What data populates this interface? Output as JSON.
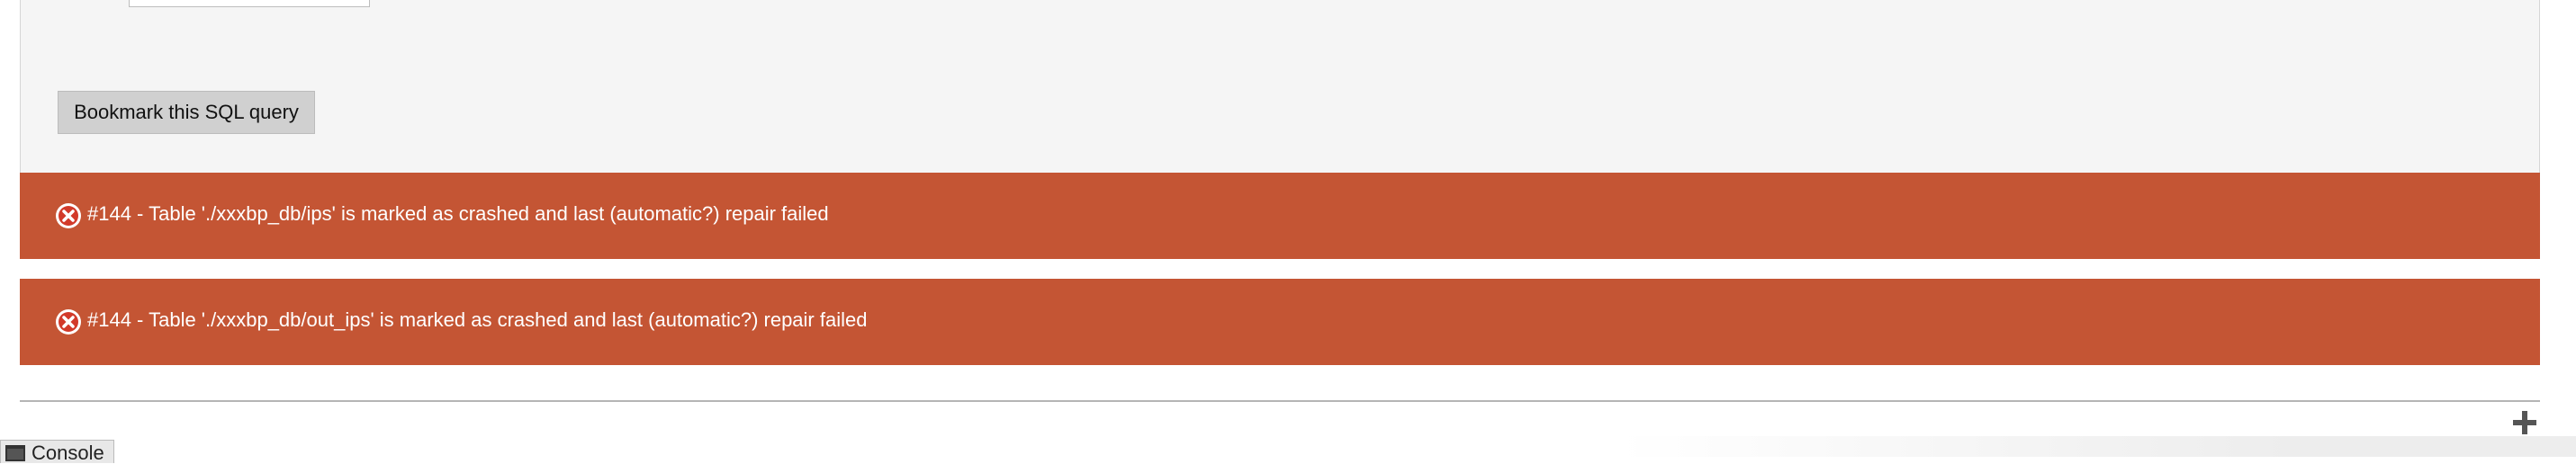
{
  "query_panel": {
    "bookmark_button_label": "Bookmark this SQL query"
  },
  "errors": [
    {
      "message": "#144 - Table './xxxbp_db/ips' is marked as crashed and last (automatic?) repair failed",
      "icon": "error-x-icon"
    },
    {
      "message": "#144 - Table './xxxbp_db/out_ips' is marked as crashed and last (automatic?) repair failed",
      "icon": "error-x-icon"
    }
  ],
  "console": {
    "label": "Console",
    "icon": "console-icon"
  },
  "toolbar": {
    "expand_icon": "plus-icon"
  },
  "colors": {
    "error_background": "#c45534",
    "panel_background": "#f5f5f5",
    "button_background": "#d0d0d0"
  }
}
